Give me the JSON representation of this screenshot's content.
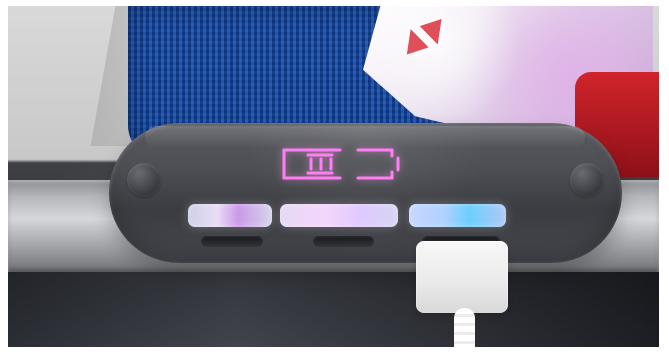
{
  "image": {
    "scene": "power-bank-on-rail",
    "subject": "power-bank",
    "display_icon": "battery-icon",
    "colors": {
      "device_body": "#4c4e54",
      "display_glow": "#ff7ef5",
      "light_left": "#d8b7f2",
      "light_center": "#efd3ff",
      "light_right": "#73d8ff",
      "cable": "#f4f4f4",
      "seat": "#2758a9"
    },
    "battery_level": 0.4
  }
}
